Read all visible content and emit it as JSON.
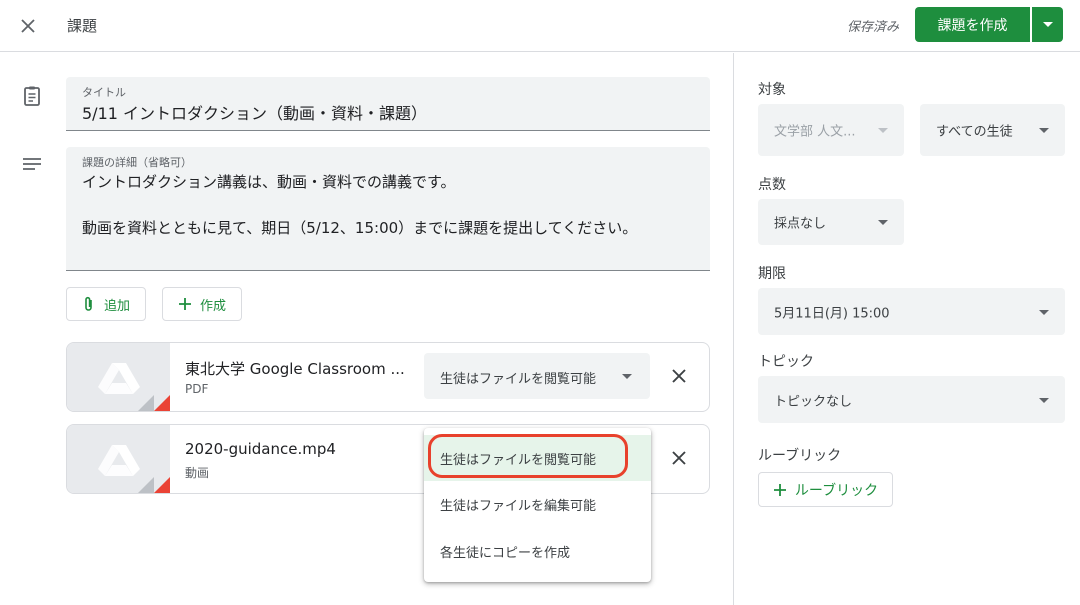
{
  "header": {
    "title": "課題",
    "saved_status": "保存済み",
    "create_label": "課題を作成"
  },
  "form": {
    "title_label": "タイトル",
    "title_value": "5/11 イントロダクション（動画・資料・課題）",
    "details_label": "課題の詳細（省略可）",
    "details_lines": [
      "イントロダクション講義は、動画・資料での講義です。",
      "動画を資料とともに見て、期日（5/12、15:00）までに課題を提出してください。"
    ],
    "add_label": "追加",
    "create_label": "作成"
  },
  "attachments": [
    {
      "name": "東北大学 Google Classroom ...",
      "type": "PDF",
      "permission": "生徒はファイルを閲覧可能"
    },
    {
      "name": "2020-guidance.mp4",
      "type": "動画"
    }
  ],
  "permission_menu": {
    "options": [
      "生徒はファイルを閲覧可能",
      "生徒はファイルを編集可能",
      "各生徒にコピーを作成"
    ],
    "selected_index": 0,
    "highlight_color": "#e8412c"
  },
  "sidebar": {
    "target_label": "対象",
    "class_value": "文学部 人文...",
    "students_value": "すべての生徒",
    "points_label": "点数",
    "points_value": "採点なし",
    "due_label": "期限",
    "due_value": "5月11日(月) 15:00",
    "topic_label": "トピック",
    "topic_value": "トピックなし",
    "rubric_label": "ルーブリック",
    "rubric_button": "ルーブリック"
  },
  "colors": {
    "accent": "#1e8e3e",
    "field_bg": "#f1f3f4",
    "selected_bg": "#e6f4ea"
  }
}
